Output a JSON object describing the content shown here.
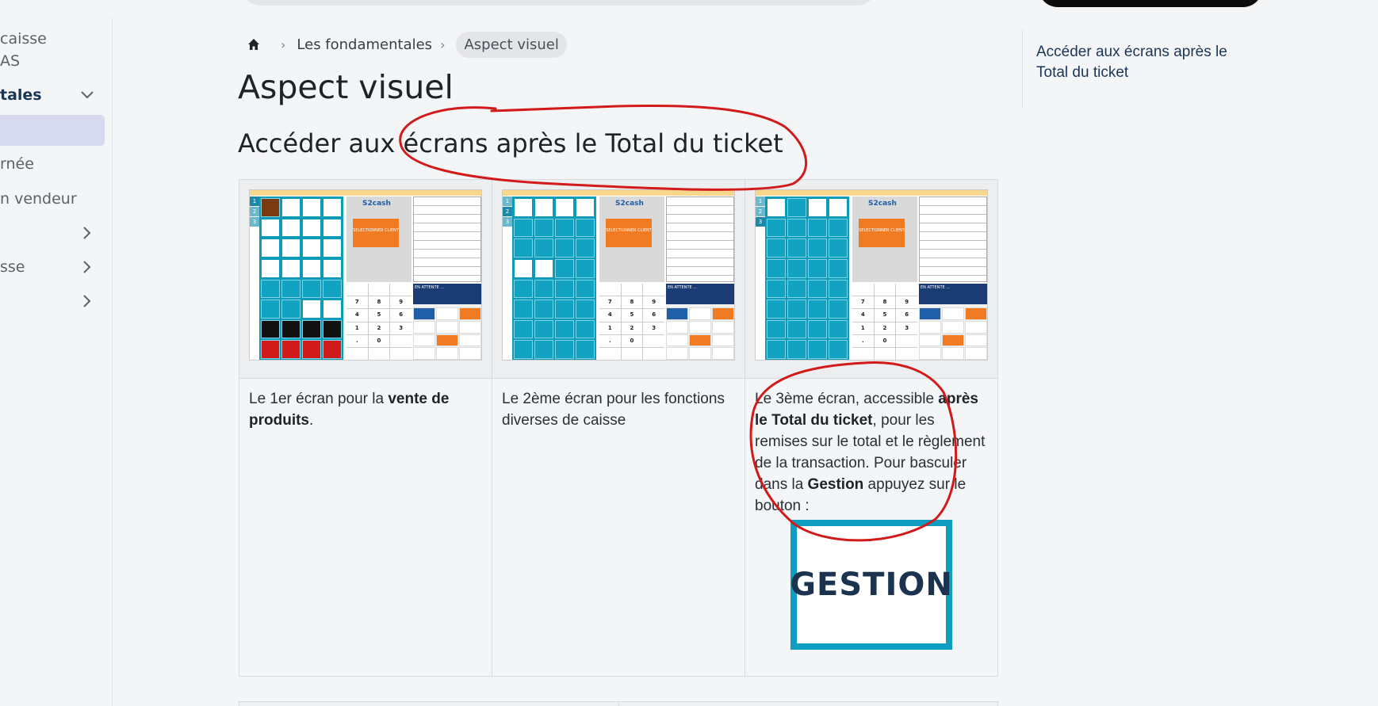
{
  "sidebar": {
    "items": [
      {
        "label": "caisse",
        "active": false
      },
      {
        "label": "AS",
        "active": false
      },
      {
        "label": "tales",
        "active": true,
        "expanded": true
      },
      {
        "label": "",
        "active": true,
        "selected": true
      },
      {
        "label": "rnée",
        "active": false
      },
      {
        "label": "n vendeur",
        "active": false
      },
      {
        "label": "",
        "active": false,
        "has_children": true
      },
      {
        "label": "sse",
        "active": false,
        "has_children": true
      },
      {
        "label": "",
        "active": false,
        "has_children": true
      }
    ]
  },
  "breadcrumb": {
    "home_icon": "home-icon",
    "items": [
      "Les fondamentales",
      "Aspect visuel"
    ]
  },
  "page": {
    "title": "Aspect visuel",
    "section_title": "Accéder aux écrans après le Total du ticket"
  },
  "table": {
    "col1": {
      "text_before": "Le 1er écran pour la ",
      "bold": "vente de produits",
      "text_after": "."
    },
    "col2": {
      "text": "Le 2ème écran pour les fonctions diverses de caisse"
    },
    "col3": {
      "text_before": "Le 3ème écran, accessible ",
      "bold1": "après le Total du ticket",
      "text_middle": ", pour les remises sur le total et le règlement de la transaction. Pour basculer dans la ",
      "bold2": "Gestion",
      "text_after": " appuyez sur le bouton :",
      "button_image_label": "GESTION"
    }
  },
  "pos_screens": {
    "keypad": [
      "7",
      "8",
      "9",
      "4",
      "5",
      "6",
      "1",
      "2",
      "3",
      ".",
      "0",
      ""
    ],
    "logo": "S2cash",
    "select_client": "SELECTIONNER CLIENT",
    "attente": "EN ATTENTE ..."
  },
  "toc": {
    "link": "Accéder aux écrans après le Total du ticket"
  },
  "colors": {
    "accent": "#1a3556",
    "annotation": "#d21a1a",
    "pos_teal": "#0e9ab9",
    "pos_orange": "#f07b22"
  }
}
